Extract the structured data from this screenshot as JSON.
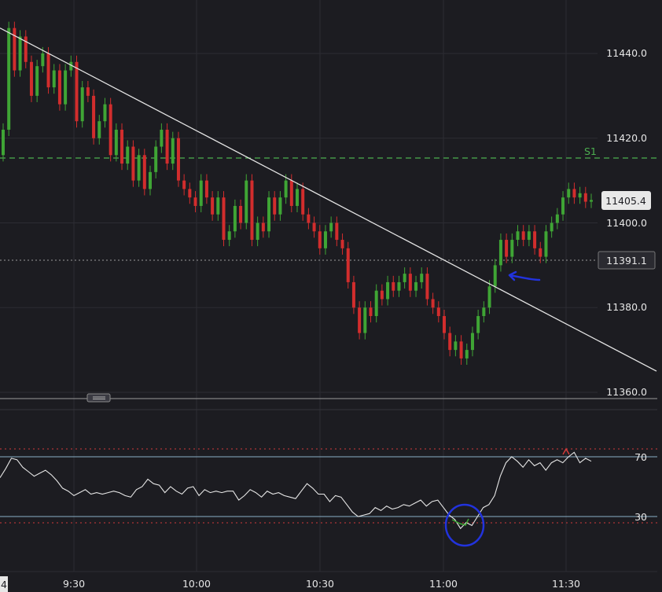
{
  "chart_data": {
    "type": "candlestick",
    "price_axis": {
      "ticks": [
        "11440.0",
        "11420.0",
        "11400.0",
        "11380.0",
        "11360.0"
      ],
      "tick_values": [
        11440,
        11420,
        11400,
        11380,
        11360
      ],
      "range": [
        11352,
        11452
      ]
    },
    "time_axis": {
      "ticks": [
        "9:30",
        "10:00",
        "10:30",
        "11:00",
        "11:30"
      ],
      "range_minutes_after_0915": [
        0,
        135
      ],
      "tick_minutes_after_0915": [
        15,
        45,
        75,
        105,
        135
      ]
    },
    "left_edge_label": "4",
    "levels": {
      "s1": {
        "label": "S1",
        "value": 11415,
        "color": "#4caf50"
      },
      "last_price": {
        "label": "11405.4",
        "value": 11405.4
      },
      "crosshair_price": {
        "label": "11391.1",
        "value": 11391.1
      }
    },
    "trendline": {
      "from": [
        0,
        11446
      ],
      "to": [
        160,
        11365
      ],
      "color": "#e6e6e6"
    },
    "colors": {
      "up": "#3fa535",
      "down": "#d22d2d",
      "background": "#1c1c21",
      "grid": "#2c2c33"
    },
    "candles_close": [
      11422,
      11446,
      11436,
      11444,
      11438,
      11430,
      11437,
      11440,
      11432,
      11436,
      11428,
      11436,
      11438,
      11424,
      11432,
      11430,
      11420,
      11424,
      11428,
      11416,
      11422,
      11414,
      11418,
      11410,
      11416,
      11408,
      11412,
      11418,
      11422,
      11414,
      11420,
      11410,
      11408,
      11406,
      11404,
      11410,
      11406,
      11402,
      11406,
      11396,
      11398,
      11404,
      11400,
      11410,
      11396,
      11400,
      11398,
      11406,
      11402,
      11406,
      11410,
      11404,
      11408,
      11402,
      11400,
      11398,
      11394,
      11398,
      11400,
      11396,
      11394,
      11386,
      11380,
      11374,
      11380,
      11378,
      11384,
      11382,
      11386,
      11384,
      11386,
      11388,
      11384,
      11386,
      11388,
      11382,
      11380,
      11378,
      11374,
      11370,
      11372,
      11368,
      11370,
      11374,
      11378,
      11380,
      11385,
      11390,
      11396,
      11392,
      11396,
      11398,
      11396,
      11398,
      11394,
      11392,
      11398,
      11400,
      11402,
      11406,
      11408,
      11406,
      11407,
      11405,
      11405.4
    ],
    "rsi": {
      "levels": {
        "upper": "70",
        "lower": "30"
      },
      "values": [
        56,
        62,
        69,
        68,
        63,
        60,
        57,
        59,
        61,
        58,
        54,
        49,
        47,
        44,
        46,
        48,
        45,
        46,
        45,
        46,
        47,
        46,
        44,
        43,
        48,
        50,
        55,
        52,
        51,
        46,
        50,
        47,
        45,
        49,
        50,
        44,
        48,
        46,
        47,
        46,
        47,
        47,
        41,
        44,
        48,
        46,
        43,
        47,
        45,
        46,
        44,
        43,
        42,
        47,
        52,
        49,
        45,
        45,
        40,
        44,
        43,
        38,
        33,
        30,
        31,
        32,
        36,
        34,
        37,
        35,
        36,
        38,
        37,
        39,
        41,
        37,
        40,
        41,
        36,
        31,
        28,
        22,
        26,
        24,
        30,
        36,
        38,
        44,
        57,
        66,
        70,
        67,
        63,
        68,
        64,
        66,
        61,
        66,
        68,
        66,
        70,
        73,
        66,
        69,
        67
      ]
    }
  }
}
